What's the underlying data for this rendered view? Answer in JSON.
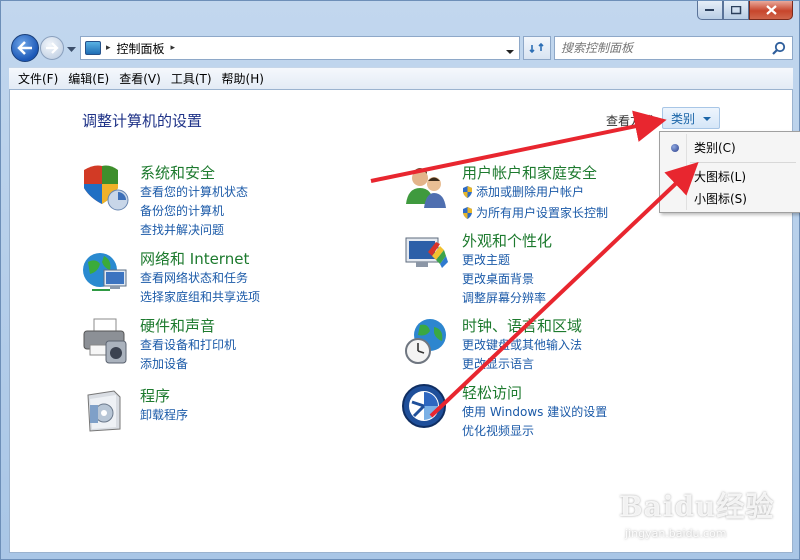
{
  "address": {
    "path": "控制面板",
    "sep": "▸"
  },
  "search": {
    "placeholder": "搜索控制面板"
  },
  "menu": [
    "文件(F)",
    "编辑(E)",
    "查看(V)",
    "工具(T)",
    "帮助(H)"
  ],
  "content": {
    "heading": "调整计算机的设置",
    "view_by_label": "查看方式：",
    "view_by_value": "类别"
  },
  "categories": [
    {
      "title": "系统和安全",
      "links": [
        "查看您的计算机状态",
        "备份您的计算机",
        "查找并解决问题"
      ]
    },
    {
      "title": "网络和 Internet",
      "links": [
        "查看网络状态和任务",
        "选择家庭组和共享选项"
      ]
    },
    {
      "title": "硬件和声音",
      "links": [
        "查看设备和打印机",
        "添加设备"
      ]
    },
    {
      "title": "程序",
      "links": [
        "卸载程序"
      ]
    },
    {
      "title": "用户帐户和家庭安全",
      "links": [
        "添加或删除用户帐户",
        "为所有用户设置家长控制"
      ]
    },
    {
      "title": "外观和个性化",
      "links": [
        "更改主题",
        "更改桌面背景",
        "调整屏幕分辨率"
      ]
    },
    {
      "title": "时钟、语言和区域",
      "links": [
        "更改键盘或其他输入法",
        "更改显示语言"
      ]
    },
    {
      "title": "轻松访问",
      "links": [
        "使用 Windows 建议的设置",
        "优化视频显示"
      ]
    }
  ],
  "popup": {
    "options": [
      "类别(C)",
      "大图标(L)",
      "小图标(S)"
    ],
    "selected": "类别(C)"
  },
  "watermark": {
    "text": "Baidu经验",
    "url": "jingyan.baidu.com"
  },
  "colors": {
    "annotation": "#e8262f",
    "link": "#1b5aa8",
    "category_title": "#1d7a2e"
  }
}
